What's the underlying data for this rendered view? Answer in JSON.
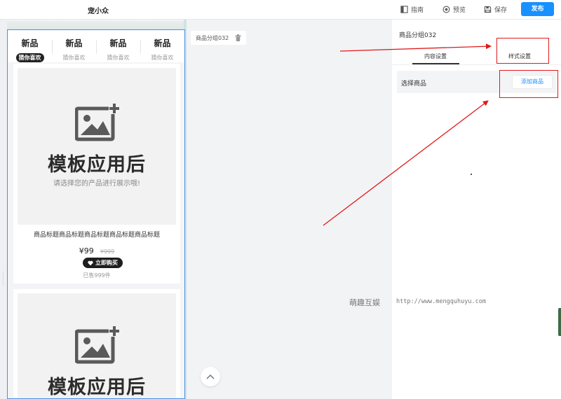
{
  "app": {
    "logo": "宠小众"
  },
  "toolbar": {
    "guide_label": "指南",
    "preview_label": "预览",
    "save_label": "保存",
    "publish_label": "发布",
    "accent_color": "#1890ff"
  },
  "preview": {
    "tabs": [
      {
        "title": "新品",
        "subtitle": "猜你喜欢",
        "active": true
      },
      {
        "title": "新品",
        "subtitle": "猜你喜欢",
        "active": false
      },
      {
        "title": "新品",
        "subtitle": "猜你喜欢",
        "active": false
      },
      {
        "title": "新品",
        "subtitle": "猜你喜欢",
        "active": false
      }
    ],
    "placeholder": {
      "title": "模板应用后",
      "subtitle": "请选择您的产品进行展示哦!",
      "icon": "image-add-icon"
    },
    "product": {
      "title": "商品标题商品标题商品标题商品标题商品标题",
      "price": "¥99",
      "old_price": "¥999",
      "buy_label": "立即购买",
      "sold": "已售999件"
    }
  },
  "component_tag": {
    "label": "商品分组032"
  },
  "panel": {
    "title": "商品分组032",
    "tab_content": "内容设置",
    "tab_style": "样式设置",
    "select_label": "选择商品",
    "add_button": "添加商品"
  },
  "watermark": {
    "name": "萌趣互娱",
    "url": "http://www.mengquhuyu.com"
  },
  "annotation_color": "#e0191b"
}
